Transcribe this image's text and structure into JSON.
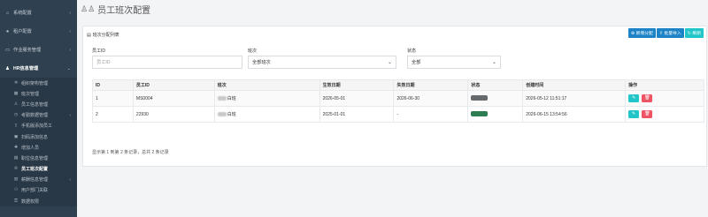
{
  "sidebar": {
    "items": [
      {
        "label": "系统配置",
        "icon": "bank-icon",
        "glyph": "⌂"
      },
      {
        "label": "租户配置",
        "icon": "user-icon",
        "glyph": "●"
      },
      {
        "label": "作业服务管理",
        "icon": "monitor-icon",
        "glyph": "▭"
      }
    ],
    "open_group": {
      "label": "HR信息管理",
      "icon": "user-group-icon",
      "glyph": "♟"
    },
    "sub_items": [
      {
        "label": "组织架构管理",
        "icon": "gears-icon",
        "glyph": "✲"
      },
      {
        "label": "班次管理",
        "icon": "calendar-icon",
        "glyph": "▦"
      },
      {
        "label": "员工信息管理",
        "icon": "male-icon",
        "glyph": "♙"
      },
      {
        "label": "考勤数据管理",
        "icon": "clock-icon",
        "glyph": "◷",
        "expandable": true
      },
      {
        "label": "手机版添加员工",
        "icon": "mobile-icon",
        "glyph": "▯"
      },
      {
        "label": "扫码添加信息",
        "icon": "qrcode-icon",
        "glyph": "▣"
      },
      {
        "label": "增加人员",
        "icon": "user-plus-icon",
        "glyph": "✚"
      },
      {
        "label": "职位信息管理",
        "icon": "briefcase-icon",
        "glyph": "▤"
      },
      {
        "label": "员工班次配置",
        "icon": "team-icon",
        "glyph": "♲",
        "active": true
      },
      {
        "label": "薪酬信息管理",
        "icon": "money-icon",
        "glyph": "▥",
        "expandable": true
      },
      {
        "label": "用户部门关联",
        "icon": "link-icon",
        "glyph": "⚇"
      },
      {
        "label": "数据权限",
        "icon": "lock-icon",
        "glyph": "⚿"
      }
    ]
  },
  "header": {
    "title": "员工班次配置",
    "icon": "users-icon"
  },
  "card": {
    "title": "班次分配列表",
    "toolbar": {
      "add_label": "新增分配",
      "import_label": "批量导入",
      "refresh_label": "刷新"
    },
    "filters": {
      "employee_id": {
        "label": "员工ID",
        "placeholder": "员工ID"
      },
      "shift": {
        "label": "班次",
        "value": "全部班次"
      },
      "status": {
        "label": "状态",
        "value": "全部"
      }
    },
    "table": {
      "headers": [
        "ID",
        "员工ID",
        "班次",
        "生效日期",
        "失效日期",
        "状态",
        "创建时间",
        "操作"
      ],
      "rows": [
        {
          "id": "1",
          "employee_id": "MS0004",
          "shift_suffix": "白班",
          "start": "2026-05-01",
          "end": "2026-06-30",
          "status_color": "#676a6c",
          "created": "2026-05-12 11:51:17"
        },
        {
          "id": "2",
          "employee_id": "22930",
          "shift_suffix": "白班",
          "start": "2025-01-01",
          "end": "-",
          "status_color": "#2e7d52",
          "created": "2026-06-15 13:54:56"
        }
      ]
    },
    "pager": "显示第 1 到第 2 条记录，总共 2 条记录"
  },
  "colors": {
    "sidebar": "#2f4050",
    "primary": "#1c84c6",
    "info": "#23c6c8",
    "danger": "#ed5565"
  }
}
